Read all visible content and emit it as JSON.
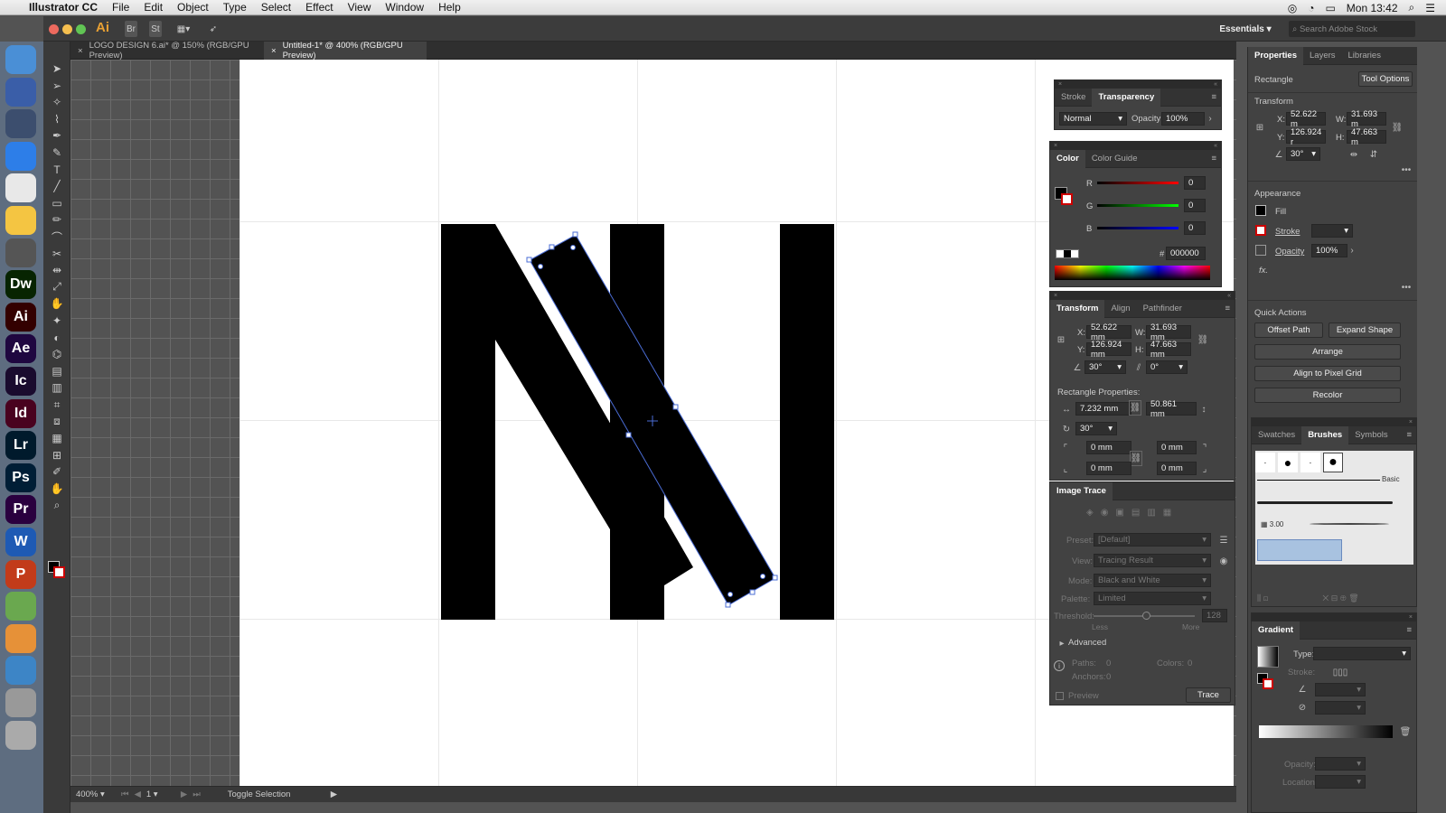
{
  "menubar": {
    "app": "Illustrator CC",
    "items": [
      "File",
      "Edit",
      "Object",
      "Type",
      "Select",
      "Effect",
      "View",
      "Window",
      "Help"
    ],
    "clock": "Mon 13:42"
  },
  "appbar": {
    "app_logo": "Ai",
    "br": "Br",
    "st": "St",
    "workspace": "Essentials",
    "search_placeholder": "Search Adobe Stock"
  },
  "tabs": [
    {
      "label": "LOGO DESIGN 6.ai* @ 150% (RGB/GPU Preview)"
    },
    {
      "label": "Untitled-1* @ 400% (RGB/GPU Preview)"
    }
  ],
  "status": {
    "zoom": "400%",
    "page": "1",
    "mode": "Toggle Selection"
  },
  "dock": [
    {
      "label": "",
      "color": "#4a8fd6"
    },
    {
      "label": "",
      "color": "#3a5ea8"
    },
    {
      "label": "",
      "color": "#3c4e6e"
    },
    {
      "label": "",
      "color": "#2d7ee8"
    },
    {
      "label": "",
      "color": "#e8e8e8"
    },
    {
      "label": "",
      "color": "#f4c542"
    },
    {
      "label": "",
      "color": "#555"
    },
    {
      "label": "Dw",
      "color": "#072401"
    },
    {
      "label": "Ai",
      "color": "#330000"
    },
    {
      "label": "Ae",
      "color": "#1f0740"
    },
    {
      "label": "Ic",
      "color": "#1a0b2e"
    },
    {
      "label": "Id",
      "color": "#49021f"
    },
    {
      "label": "Lr",
      "color": "#001a2c"
    },
    {
      "label": "Ps",
      "color": "#001e36"
    },
    {
      "label": "Pr",
      "color": "#2a003f"
    },
    {
      "label": "W",
      "color": "#1e5ab4"
    },
    {
      "label": "P",
      "color": "#c23b1a"
    },
    {
      "label": "",
      "color": "#6aa84f"
    },
    {
      "label": "",
      "color": "#e69138"
    },
    {
      "label": "",
      "color": "#3d85c6"
    },
    {
      "label": "",
      "color": "#999"
    },
    {
      "label": "",
      "color": "#aaa"
    }
  ],
  "transparency": {
    "tab1": "Stroke",
    "tab2": "Transparency",
    "blend": "Normal",
    "opacity_label": "Opacity:",
    "opacity": "100%"
  },
  "color": {
    "tab1": "Color",
    "tab2": "Color Guide",
    "r_label": "R",
    "g_label": "G",
    "b_label": "B",
    "r": "0",
    "g": "0",
    "b": "0",
    "hash": "#",
    "hex": "000000"
  },
  "transform": {
    "tab1": "Transform",
    "tab2": "Align",
    "tab3": "Pathfinder",
    "x_label": "X:",
    "y_label": "Y:",
    "w_label": "W:",
    "h_label": "H:",
    "x": "52.622 mm",
    "y": "126.924 mm",
    "w": "31.693 mm",
    "h": "47.663 mm",
    "angle": "30°",
    "shear": "0°",
    "rect_props": "Rectangle Properties:",
    "rw": "7.232 mm",
    "rh": "50.861 mm",
    "rangle": "30°",
    "c1": "0 mm",
    "c2": "0 mm",
    "c3": "0 mm",
    "c4": "0 mm"
  },
  "imagetrace": {
    "title": "Image Trace",
    "preset_label": "Preset:",
    "preset": "[Default]",
    "view_label": "View:",
    "view": "Tracing Result",
    "mode_label": "Mode:",
    "mode": "Black and White",
    "palette_label": "Palette:",
    "palette": "Limited",
    "threshold_label": "Threshold:",
    "threshold": "128",
    "less": "Less",
    "more": "More",
    "advanced": "Advanced",
    "paths_label": "Paths:",
    "paths": "0",
    "colors_label": "Colors:",
    "colors": "0",
    "anchors_label": "Anchors:",
    "anchors": "0",
    "preview": "Preview",
    "trace": "Trace"
  },
  "properties": {
    "tab1": "Properties",
    "tab2": "Layers",
    "tab3": "Libraries",
    "object": "Rectangle",
    "tool_options": "Tool Options",
    "transform_title": "Transform",
    "x_label": "X:",
    "y_label": "Y:",
    "w_label": "W:",
    "h_label": "H:",
    "x": "52.622 m",
    "y": "126.924 r",
    "w": "31.693 m",
    "h": "47.663 m",
    "angle": "30°",
    "appearance": "Appearance",
    "fill": "Fill",
    "stroke": "Stroke",
    "opacity": "Opacity",
    "opacity_val": "100%",
    "fx": "fx.",
    "quick_actions": "Quick Actions",
    "offset_path": "Offset Path",
    "expand_shape": "Expand Shape",
    "arrange": "Arrange",
    "align_pixel": "Align to Pixel Grid",
    "recolor": "Recolor"
  },
  "brushes": {
    "tab1": "Swatches",
    "tab2": "Brushes",
    "tab3": "Symbols",
    "basic": "Basic",
    "size": "3.00"
  },
  "gradient": {
    "title": "Gradient",
    "type_label": "Type:",
    "stroke_label": "Stroke:",
    "opacity_label": "Opacity:",
    "location_label": "Location:"
  },
  "colors": {
    "selection": "#4a6cd4",
    "artboard": "#ffffff",
    "panel": "#424242"
  }
}
